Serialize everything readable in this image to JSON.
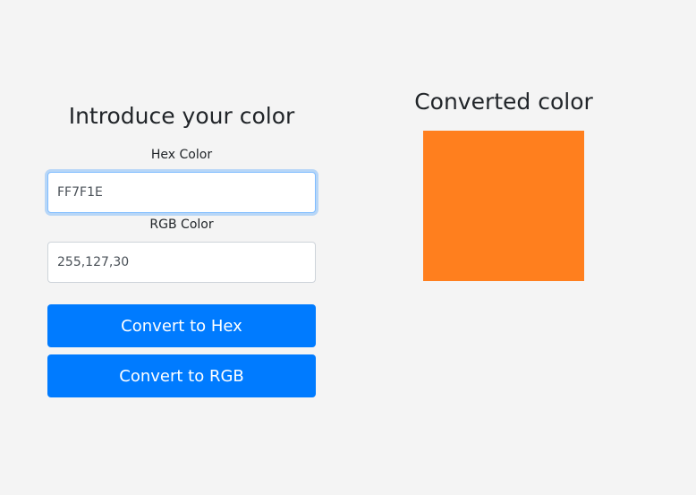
{
  "form": {
    "title": "Introduce your color",
    "hex_label": "Hex Color",
    "hex_value": "FF7F1E",
    "rgb_label": "RGB Color",
    "rgb_value": "255,127,30",
    "convert_hex_label": "Convert to Hex",
    "convert_rgb_label": "Convert to RGB"
  },
  "result": {
    "title": "Converted color",
    "swatch_color": "#FF7F1E"
  },
  "colors": {
    "button": "#007bff",
    "background": "#f4f4f4"
  }
}
